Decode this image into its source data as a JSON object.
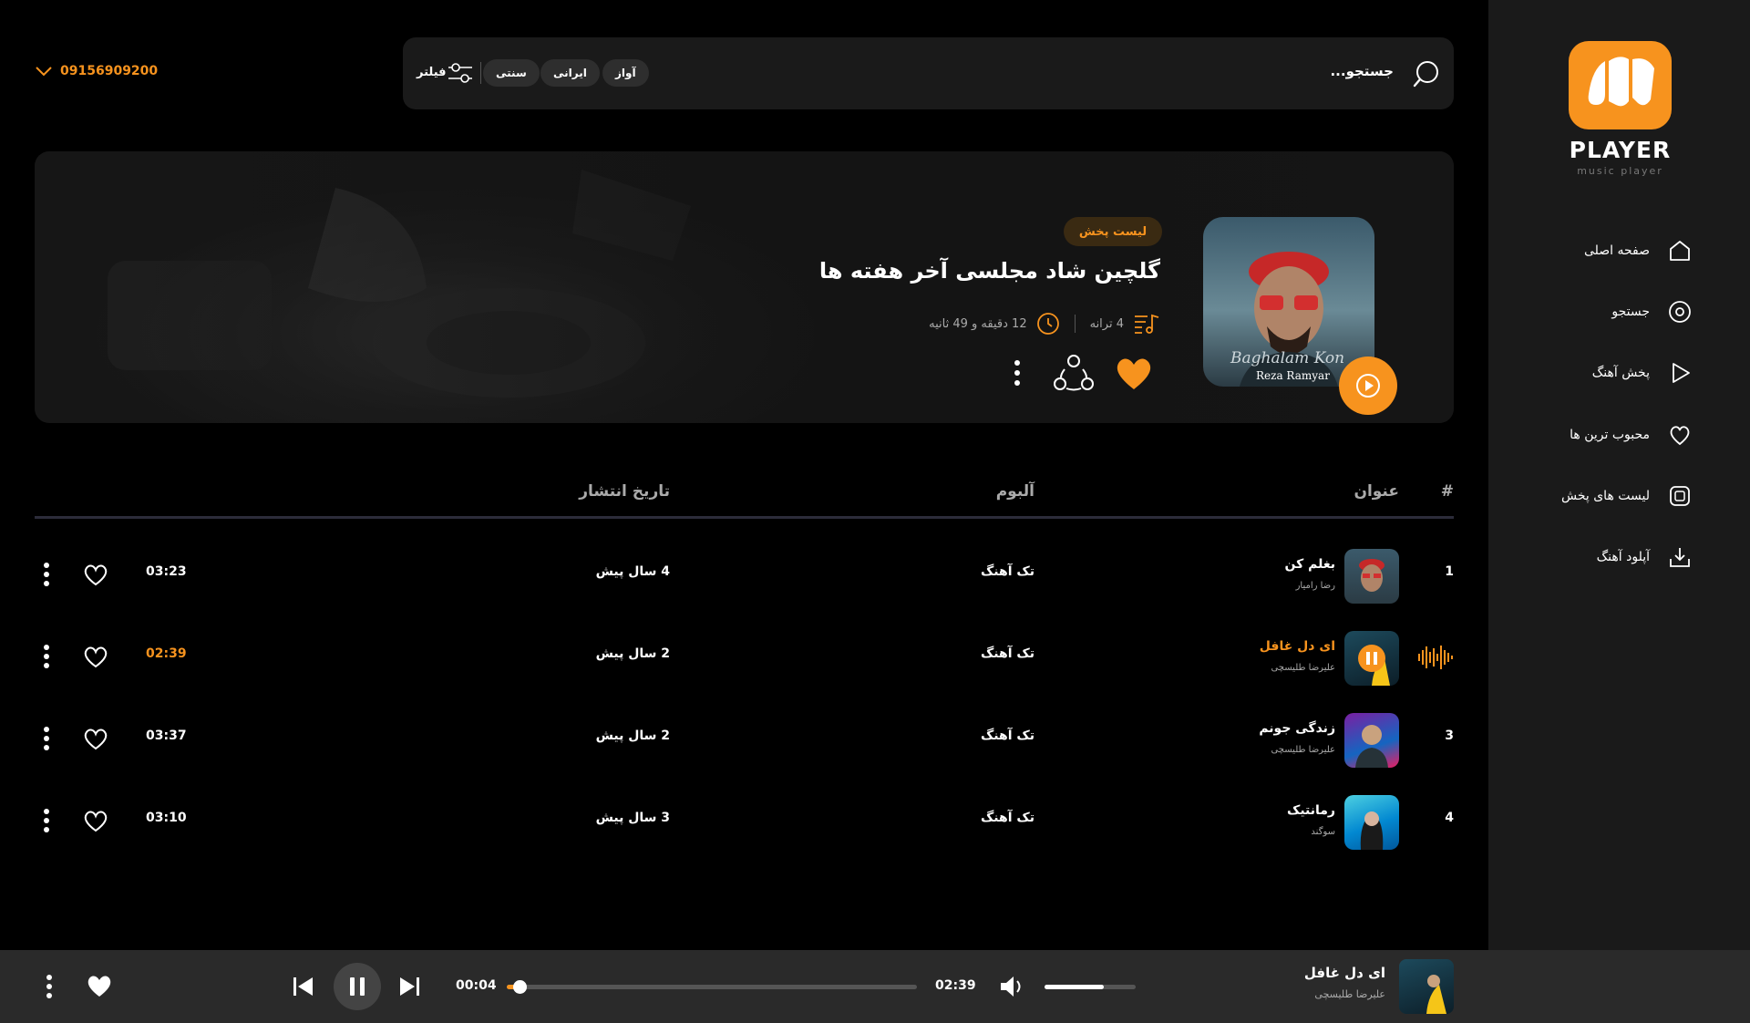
{
  "brand": {
    "name": "PLAYER",
    "tagline": "music player",
    "accent": "#f7931e"
  },
  "nav": [
    {
      "label": "صفحه اصلی",
      "icon": "home-icon"
    },
    {
      "label": "جستجو",
      "icon": "compass-icon"
    },
    {
      "label": "پخش آهنگ",
      "icon": "play-icon"
    },
    {
      "label": "محبوب ترین ها",
      "icon": "heart-icon"
    },
    {
      "label": "لیست های پخش",
      "icon": "playlist-icon"
    },
    {
      "label": "آپلود آهنگ",
      "icon": "upload-icon"
    }
  ],
  "header": {
    "phone": "09156909200",
    "search_placeholder": "جستجو...",
    "filter_label": "فیلتر",
    "chips": [
      "آواز",
      "ایرانی",
      "سنتی"
    ]
  },
  "hero": {
    "badge": "لیست پخش",
    "title": "گلچین شاد مجلسی آخر هفته ها",
    "track_count": "4 ترانه",
    "duration": "12 دقیقه و 49 ثانیه",
    "cover_text": [
      "Baghalam Kon",
      "Reza Ramyar"
    ]
  },
  "table": {
    "headers": {
      "num": "#",
      "title": "عنوان",
      "album": "آلبوم",
      "date": "تاریخ انتشار"
    },
    "rows": [
      {
        "num": "1",
        "title": "بغلم کن",
        "artist": "رضا رامیار",
        "album": "تک آهنگ",
        "date": "4 سال پیش",
        "duration": "03:23"
      },
      {
        "num": "",
        "title": "ای دل غافل",
        "artist": "علیرضا طلیسچی",
        "album": "تک آهنگ",
        "date": "2 سال پیش",
        "duration": "02:39",
        "active": true
      },
      {
        "num": "3",
        "title": "زندگی جونم",
        "artist": "علیرضا طلیسچی",
        "album": "تک آهنگ",
        "date": "2 سال پیش",
        "duration": "03:37"
      },
      {
        "num": "4",
        "title": "رمانتیک",
        "artist": "سوگند",
        "album": "تک آهنگ",
        "date": "3 سال پیش",
        "duration": "03:10"
      }
    ]
  },
  "player": {
    "title": "ای دل غافل",
    "artist": "علیرضا طلیسچی",
    "current": "00:04",
    "total": "02:39",
    "progress": 0.03,
    "volume": 0.65
  }
}
